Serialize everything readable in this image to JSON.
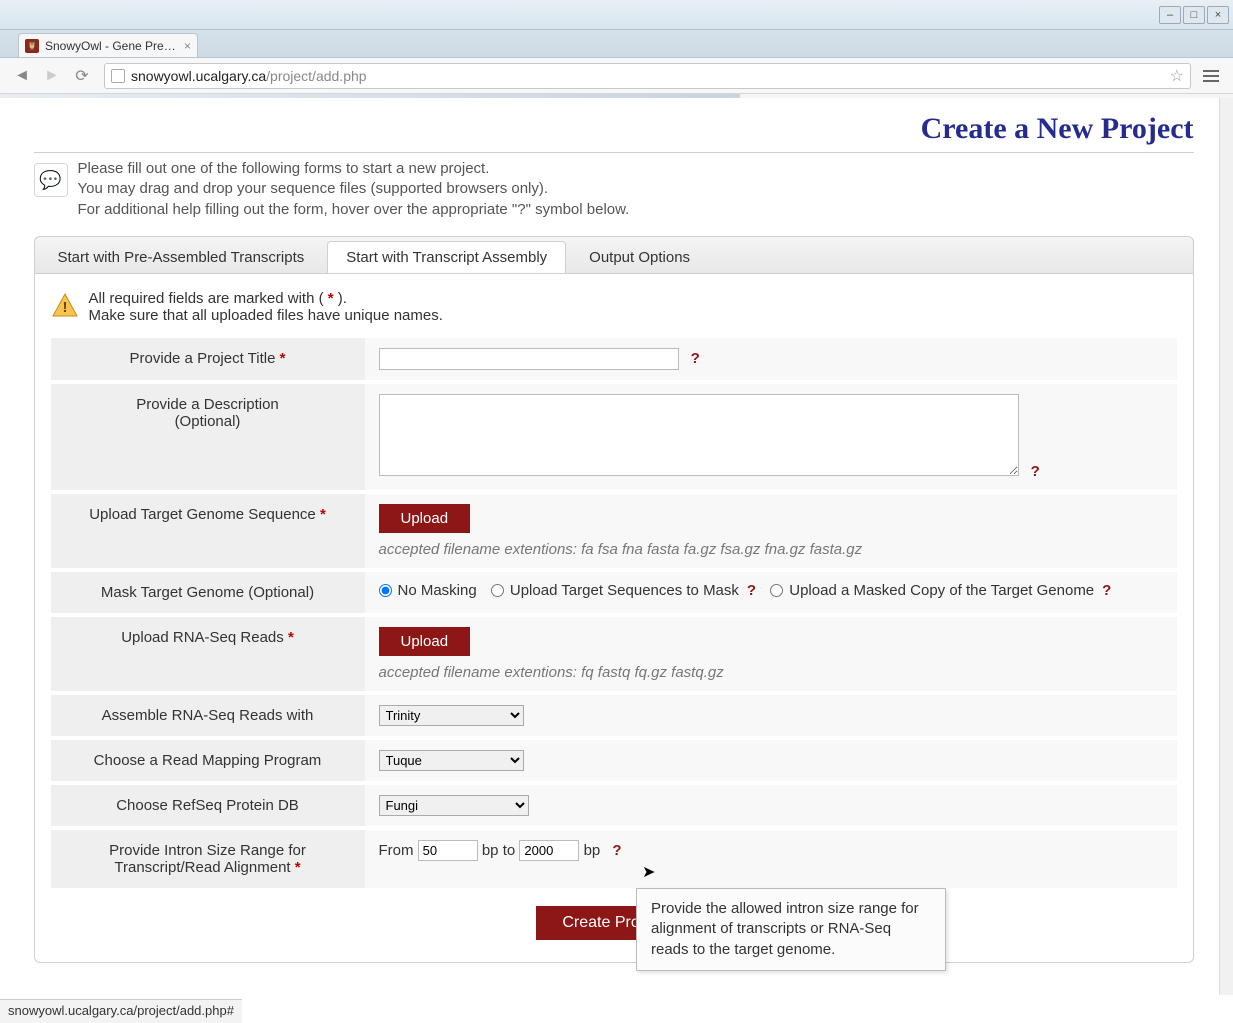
{
  "window": {
    "min": "–",
    "max": "□",
    "close": "×"
  },
  "browser": {
    "tab_title": "SnowyOwl - Gene Predict",
    "url_host": "snowyowl.ucalgary.ca",
    "url_path": "/project/add.php"
  },
  "page": {
    "title": "Create a New Project",
    "intro_line1": "Please fill out one of the following forms to start a new project.",
    "intro_line2": "You may drag and drop your sequence files (supported browsers only).",
    "intro_line3": "For additional help filling out the form, hover over the appropriate \"?\" symbol below."
  },
  "tabs": {
    "t1": "Start with Pre-Assembled Transcripts",
    "t2": "Start with Transcript Assembly",
    "t3": "Output Options"
  },
  "notice": {
    "line1_a": "All required fields are marked with ( ",
    "line1_star": "*",
    "line1_b": " ).",
    "line2": "Make sure that all uploaded files have unique names."
  },
  "fields": {
    "title_label": "Provide a Project Title",
    "desc_label_a": "Provide a Description",
    "desc_label_b": "(Optional)",
    "genome_label": "Upload Target Genome Sequence",
    "genome_hint": "accepted filename extentions: fa fsa fna fasta fa.gz fsa.gz fna.gz fasta.gz",
    "mask_label": "Mask Target Genome (Optional)",
    "mask_opt1": "No Masking",
    "mask_opt2": "Upload Target Sequences to Mask",
    "mask_opt3": "Upload a Masked Copy of the Target Genome",
    "rnaseq_label": "Upload RNA-Seq Reads",
    "rnaseq_hint": "accepted filename extentions: fq fastq fq.gz fastq.gz",
    "assemble_label": "Assemble RNA-Seq Reads with",
    "assemble_value": "Trinity",
    "mapping_label": "Choose a Read Mapping Program",
    "mapping_value": "Tuque",
    "refseq_label": "Choose RefSeq Protein DB",
    "refseq_value": "Fungi",
    "intron_label_a": "Provide Intron Size Range for",
    "intron_label_b": "Transcript/Read Alignment",
    "intron_from": "From",
    "intron_from_val": "50",
    "intron_to": "bp to",
    "intron_to_val": "2000",
    "intron_bp": "bp",
    "upload_btn": "Upload",
    "submit": "Create Project",
    "help_q": "?"
  },
  "tooltip": {
    "text": "Provide the allowed intron size range for alignment of transcripts or RNA-Seq reads to the target genome."
  },
  "status": {
    "text": "snowyowl.ucalgary.ca/project/add.php#"
  }
}
